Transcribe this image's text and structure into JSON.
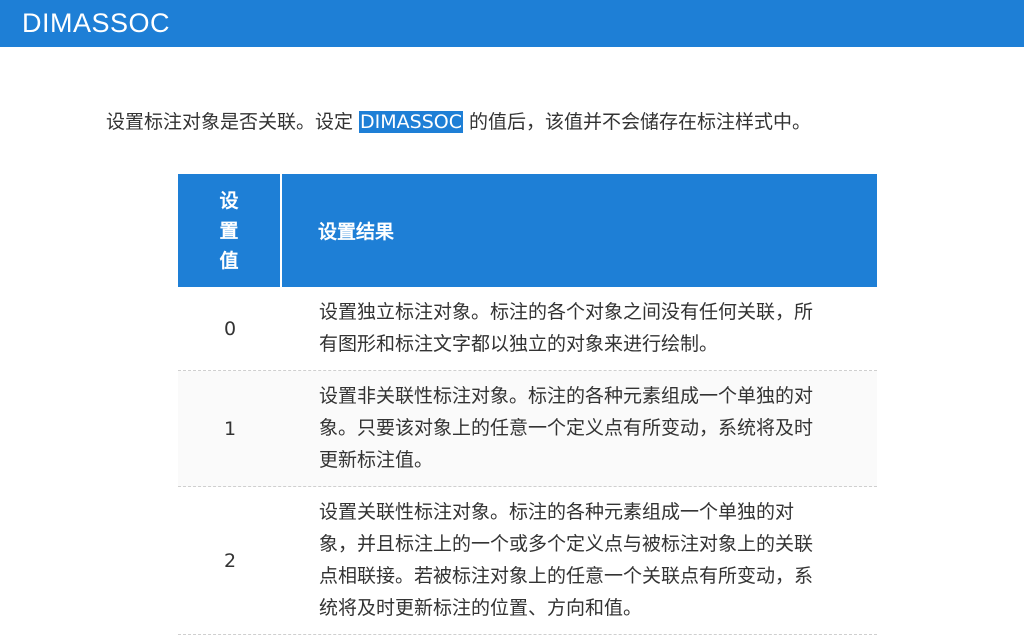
{
  "header": {
    "title": "DIMASSOC"
  },
  "intro": {
    "before": "设置标注对象是否关联。设定 ",
    "highlight": "DIMASSOC",
    "after": " 的值后，该值并不会储存在标注样式中。"
  },
  "table": {
    "headers": {
      "value": "设置值",
      "result": "设置结果"
    },
    "rows": [
      {
        "value": "0",
        "result": "设置独立标注对象。标注的各个对象之间没有任何关联，所有图形和标注文字都以独立的对象来进行绘制。"
      },
      {
        "value": "1",
        "result": "设置非关联性标注对象。标注的各种元素组成一个单独的对象。只要该对象上的任意一个定义点有所变动，系统将及时更新标注值。"
      },
      {
        "value": "2",
        "result": "设置关联性标注对象。标注的各种元素组成一个单独的对象，并且标注上的一个或多个定义点与被标注对象上的关联点相联接。若被标注对象上的任意一个关联点有所变动，系统将及时更新标注的位置、方向和值。"
      }
    ]
  }
}
